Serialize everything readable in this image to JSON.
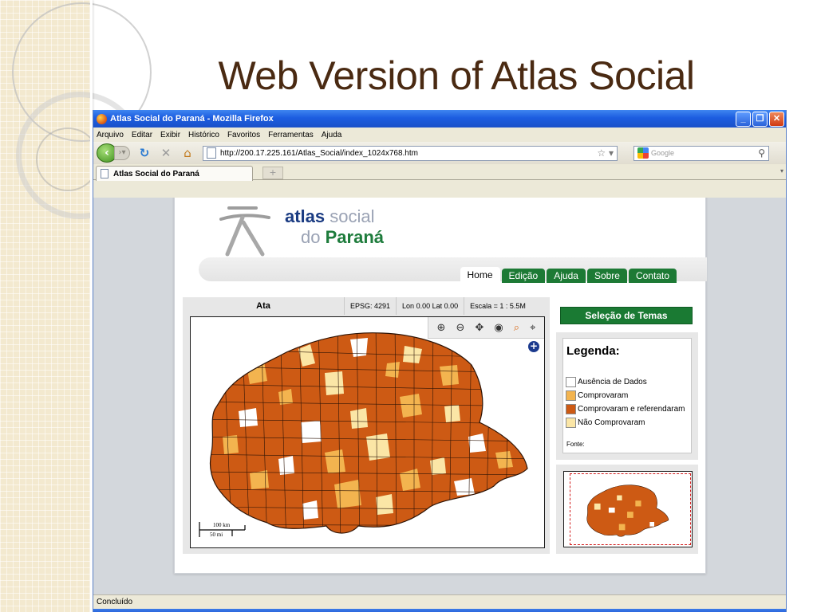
{
  "slide": {
    "title": "Web Version of Atlas Social"
  },
  "browser": {
    "window_title": "Atlas Social do Paraná - Mozilla Firefox",
    "menu": [
      "Arquivo",
      "Editar",
      "Exibir",
      "Histórico",
      "Favoritos",
      "Ferramentas",
      "Ajuda"
    ],
    "url": "http://200.17.225.161/Atlas_Social/index_1024x768.htm",
    "search_placeholder": "Google",
    "tab_title": "Atlas Social do Paraná",
    "new_tab_glyph": "+",
    "status": "Concluído"
  },
  "site": {
    "logo_atlas": "atlas",
    "logo_social": "social",
    "logo_do": "do",
    "logo_parana": "Paraná",
    "nav_tabs": [
      "Home",
      "Edição",
      "Ajuda",
      "Sobre",
      "Contato"
    ],
    "active_tab": "Home",
    "map": {
      "title": "Ata",
      "epsg": "EPSG: 4291",
      "coords": "Lon 0.00 Lat 0.00",
      "scale": "Escala = 1 : 5.5M",
      "scalebar_km": "100 km",
      "scalebar_mi": "50 mi"
    },
    "theme_button": "Seleção de Temas",
    "legend": {
      "title": "Legenda:",
      "items": [
        {
          "label": "Ausência de Dados",
          "color": "#ffffff"
        },
        {
          "label": "Comprovaram",
          "color": "#f3b44f"
        },
        {
          "label": "Comprovaram e referendaram",
          "color": "#cd5a14"
        },
        {
          "label": "Não Comprovaram",
          "color": "#fbe6a6"
        }
      ],
      "source": "Fonte:"
    }
  },
  "colors": {
    "title_text": "#4a2a12",
    "nav_green": "#1d7a35",
    "map_main": "#cd5a14",
    "map_light": "#f3b44f",
    "map_pale": "#fbe6a6"
  }
}
